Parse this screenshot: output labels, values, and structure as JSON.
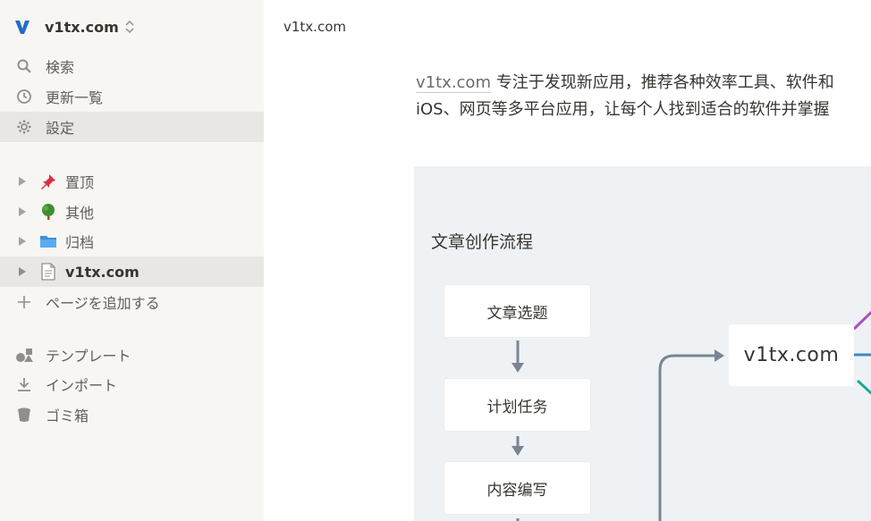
{
  "workspace": {
    "name": "v1tx.com",
    "logo_letter": "V",
    "logo_color": "#1f6fc5"
  },
  "nav": {
    "search": "検索",
    "updates": "更新一覧",
    "settings": "設定"
  },
  "pages": [
    {
      "label": "置顶",
      "icon": "pushpin-icon"
    },
    {
      "label": "其他",
      "icon": "tree-icon"
    },
    {
      "label": "归档",
      "icon": "folder-icon"
    },
    {
      "label": "v1tx.com",
      "icon": "page-icon"
    }
  ],
  "add_page": "ページを追加する",
  "tools": {
    "templates": "テンプレート",
    "import": "インポート",
    "trash": "ゴミ箱"
  },
  "main": {
    "breadcrumb": "v1tx.com",
    "paragraph": {
      "link": "v1tx.com",
      "line1_rest": " 专注于发现新应用，推荐各种效率工具、软件和",
      "line2": "iOS、网页等多平台应用，让每个人找到适合的软件并掌握"
    },
    "diagram": {
      "title": "文章创作流程",
      "steps": [
        "文章选题",
        "计划任务",
        "内容编写"
      ],
      "hub": "v1tx.com"
    }
  },
  "colors": {
    "sidebar_bg": "#f7f6f3",
    "active_row": "#e8e7e4",
    "diagram_bg": "#eff2f5",
    "arrow": "#7a8593",
    "branch_purple": "#b04ac9",
    "branch_blue": "#3d88c8",
    "branch_teal": "#1aa89a"
  }
}
